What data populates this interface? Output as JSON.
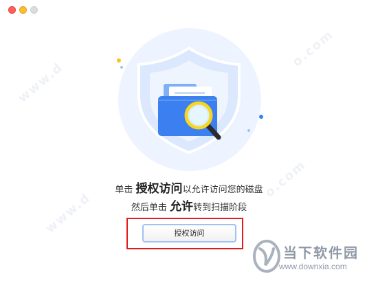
{
  "window": {
    "controls": [
      "close",
      "minimize",
      "zoom"
    ]
  },
  "illustration": {
    "icons": [
      "shield-icon",
      "folder-icon",
      "magnifier-icon"
    ]
  },
  "instructions": {
    "line1_pre": "单击 ",
    "line1_em": "授权访问",
    "line1_post": "以允许访问您的磁盘",
    "line2_pre": "然后单击 ",
    "line2_em": "允许",
    "line2_post": "转到扫描阶段"
  },
  "authorize_button": {
    "label": "授权访问"
  },
  "watermark": {
    "brand_name": "当下软件园",
    "brand_url": "www.downxia.com"
  },
  "colors": {
    "close": "#fe5f57",
    "minimize": "#febc2e",
    "zoom": "#dcdcdc",
    "highlight_border": "#e01c1c",
    "button_border": "#9ec3f2",
    "folder_blue": "#3b7ff0"
  }
}
